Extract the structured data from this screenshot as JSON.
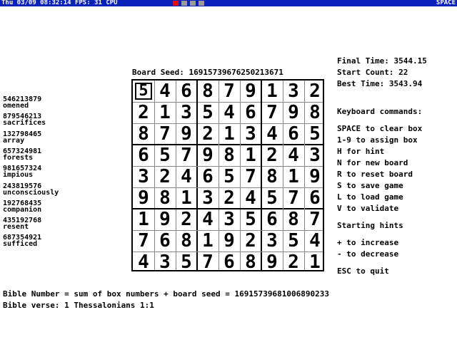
{
  "topbar": {
    "clock": "Thu 03/09 08:32:14",
    "fps_label": "FPS: 31",
    "cpu_label": "CPU",
    "space_label": "SPACE",
    "colors": {
      "bar": "#0a22b8",
      "cpu_used": "#e01010",
      "cpu_free": "#9a9a9a"
    }
  },
  "board_seed_label": "Board Seed: 16915739676250213671",
  "board": [
    [
      "5",
      "4",
      "6",
      "8",
      "7",
      "9",
      "1",
      "3",
      "2"
    ],
    [
      "2",
      "1",
      "3",
      "5",
      "4",
      "6",
      "7",
      "9",
      "8"
    ],
    [
      "8",
      "7",
      "9",
      "2",
      "1",
      "3",
      "4",
      "6",
      "5"
    ],
    [
      "6",
      "5",
      "7",
      "9",
      "8",
      "1",
      "2",
      "4",
      "3"
    ],
    [
      "3",
      "2",
      "4",
      "6",
      "5",
      "7",
      "8",
      "1",
      "9"
    ],
    [
      "9",
      "8",
      "1",
      "3",
      "2",
      "4",
      "5",
      "7",
      "6"
    ],
    [
      "1",
      "9",
      "2",
      "4",
      "3",
      "5",
      "6",
      "8",
      "7"
    ],
    [
      "7",
      "6",
      "8",
      "1",
      "9",
      "2",
      "3",
      "5",
      "4"
    ],
    [
      "4",
      "3",
      "5",
      "7",
      "6",
      "8",
      "9",
      "2",
      "1"
    ]
  ],
  "selected_cell": {
    "row": 0,
    "col": 0
  },
  "solutions": [
    {
      "number": "546213879",
      "word": "omened"
    },
    {
      "number": "879546213",
      "word": "sacrifices"
    },
    {
      "number": "132798465",
      "word": "array"
    },
    {
      "number": "657324981",
      "word": "forests"
    },
    {
      "number": "981657324",
      "word": "impious"
    },
    {
      "number": "243819576",
      "word": "unconsciously"
    },
    {
      "number": "192768435",
      "word": "companion"
    },
    {
      "number": "435192768",
      "word": "resent"
    },
    {
      "number": "687354921",
      "word": "sufficed"
    }
  ],
  "stats": {
    "final_time": "Final Time: 3544.15",
    "start_count": "Start Count: 22",
    "best_time": "Best Time: 3543.94"
  },
  "commands": {
    "heading": "Keyboard commands:",
    "items": [
      "SPACE to clear box",
      "1-9 to assign box",
      "H for hint",
      "N for new board",
      "R to reset board",
      "S to save game",
      "L to load game",
      "V to validate"
    ],
    "hints_heading": "Starting hints",
    "hints_items": [
      "+ to increase",
      "- to decrease"
    ],
    "quit": "ESC to quit"
  },
  "bible_number": "Bible Number = sum of box numbers + board seed = 16915739681006890233",
  "bible_verse": "Bible verse: 1 Thessalonians 1:1"
}
